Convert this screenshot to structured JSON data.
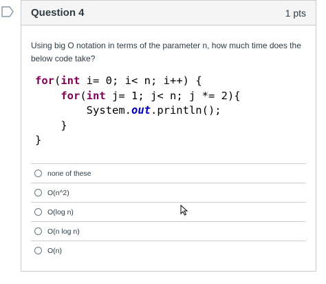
{
  "question": {
    "title": "Question 4",
    "points": "1 pts",
    "prompt": "Using big O notation in terms of the parameter n, how much time does the below code take?",
    "code": {
      "line1_kw": "for",
      "line1_a": "(",
      "line1_kw2": "int",
      "line1_b": " i= 0; i< n; i++) {",
      "line2_kw": "for",
      "line2_a": "(",
      "line2_kw2": "int",
      "line2_b": " j= 1; j< n; j *= 2){",
      "line3_a": "System.",
      "line3_field": "out",
      "line3_b": ".println();",
      "line4": "}",
      "line5": "}"
    }
  },
  "answers": [
    {
      "label": "none of these"
    },
    {
      "label": "O(n^2)"
    },
    {
      "label": "O(log n)"
    },
    {
      "label": "O(n log n)"
    },
    {
      "label": "O(n)"
    }
  ],
  "icons": {
    "flag": "bookmark-flag-icon",
    "cursor": "mouse-cursor-icon"
  },
  "colors": {
    "keyword": "#7f0055",
    "field": "#0000c0",
    "border": "#c7cdd1",
    "header_bg": "#f5f5f5"
  }
}
